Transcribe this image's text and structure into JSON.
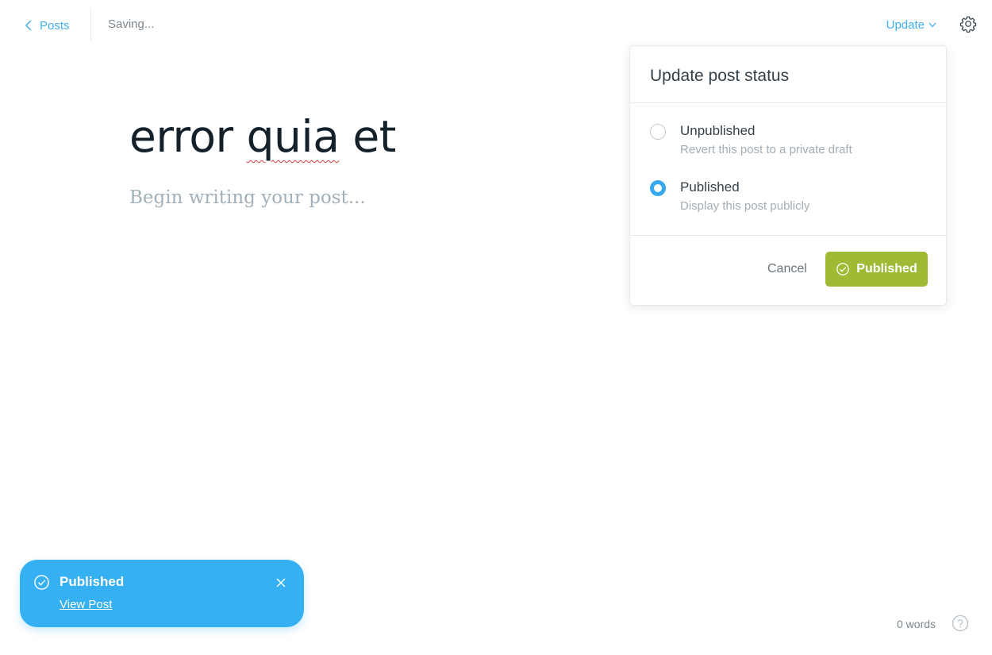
{
  "header": {
    "back_label": "Posts",
    "status_text": "Saving...",
    "update_label": "Update"
  },
  "editor": {
    "title_words": [
      "error",
      "quia",
      "et"
    ],
    "body_placeholder": "Begin writing your post..."
  },
  "status_dropdown": {
    "title": "Update post status",
    "options": [
      {
        "label": "Unpublished",
        "description": "Revert this post to a private draft",
        "selected": false
      },
      {
        "label": "Published",
        "description": "Display this post publicly",
        "selected": true
      }
    ],
    "cancel_label": "Cancel",
    "confirm_label": "Published"
  },
  "toast": {
    "title": "Published",
    "link_label": "View Post"
  },
  "footer": {
    "word_count": "0 words"
  },
  "colors": {
    "accent": "#3eb0ef",
    "success_button": "#9fbb35",
    "toast_bg": "#35b0f3",
    "radio_checked": "#37a9ec"
  },
  "icons": [
    "chevron-left-icon",
    "chevron-down-icon",
    "gear-icon",
    "check-circle-icon",
    "close-icon",
    "help-icon"
  ]
}
